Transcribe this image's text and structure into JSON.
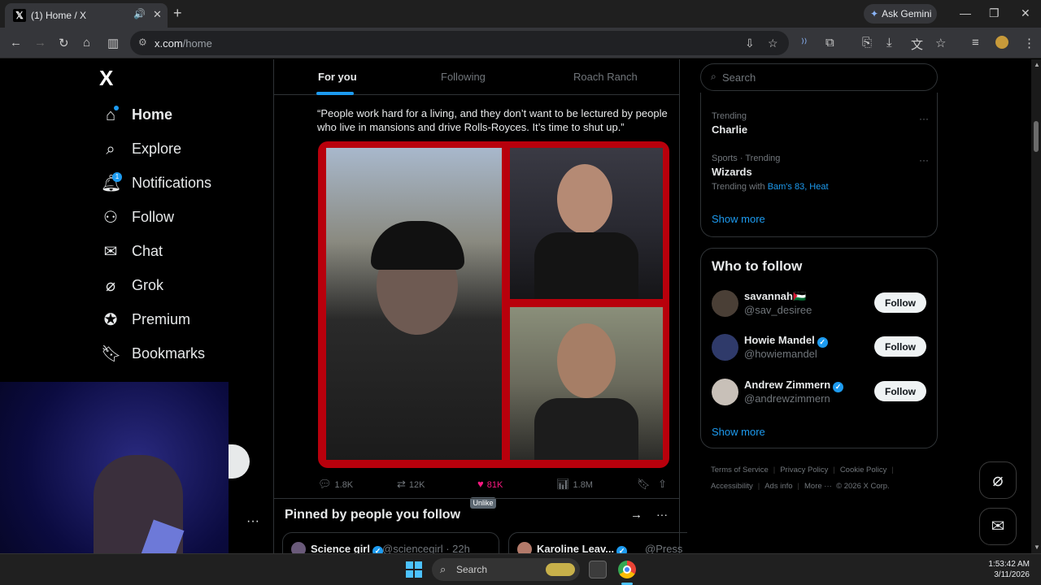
{
  "browser": {
    "tab_title": "(1) Home / X",
    "ask_gemini": "Ask Gemini",
    "url_host": "x.com",
    "url_path": "/home"
  },
  "nav": {
    "logo": "X",
    "items": [
      {
        "label": "Home",
        "icon": "home-icon"
      },
      {
        "label": "Explore",
        "icon": "search-icon"
      },
      {
        "label": "Notifications",
        "icon": "bell-icon",
        "badge": "1"
      },
      {
        "label": "Follow",
        "icon": "add-person-icon"
      },
      {
        "label": "Chat",
        "icon": "envelope-icon"
      },
      {
        "label": "Grok",
        "icon": "grok-icon"
      },
      {
        "label": "Premium",
        "icon": "verified-icon"
      },
      {
        "label": "Bookmarks",
        "icon": "bookmark-icon"
      }
    ]
  },
  "feed": {
    "tabs": [
      "For you",
      "Following",
      "Roach Ranch"
    ],
    "tweet_text": "“People work hard for a living, and they don’t want to be lectured by people who live in mansions and drive Rolls-Royces. It’s time to shut up.”",
    "actions": {
      "replies": "1.8K",
      "reposts": "12K",
      "likes": "81K",
      "views": "1.8M"
    },
    "tooltip": "Unlike",
    "pinned_title": "Pinned by people you follow",
    "pinned": [
      {
        "name": "Science girl",
        "handle": "@sciencegirl · 22h"
      },
      {
        "name": "Karoline Leav...",
        "handle": "@Press"
      }
    ]
  },
  "sidebar": {
    "search_placeholder": "Search",
    "trends": [
      {
        "meta": "Trending",
        "name": "Charlie"
      },
      {
        "meta": "Sports · Trending",
        "name": "Wizards",
        "with_label": "Trending with",
        "with_links": "Bam's 83, Heat"
      }
    ],
    "show_more": "Show more",
    "who_to_follow_title": "Who to follow",
    "who_to_follow": [
      {
        "name": "savannah🇵🇸",
        "handle": "@sav_desiree",
        "verified": false
      },
      {
        "name": "Howie Mandel",
        "handle": "@howiemandel",
        "verified": true
      },
      {
        "name": "Andrew Zimmern",
        "handle": "@andrewzimmern",
        "verified": true
      }
    ],
    "follow_label": "Follow",
    "footer": {
      "terms": "Terms of Service",
      "privacy": "Privacy Policy",
      "cookie": "Cookie Policy",
      "accessibility": "Accessibility",
      "ads": "Ads info",
      "more": "More ···",
      "copyright": "© 2026 X Corp."
    }
  },
  "taskbar": {
    "search_label": "Search",
    "time": "1:53:42 AM",
    "date": "3/11/2026"
  }
}
